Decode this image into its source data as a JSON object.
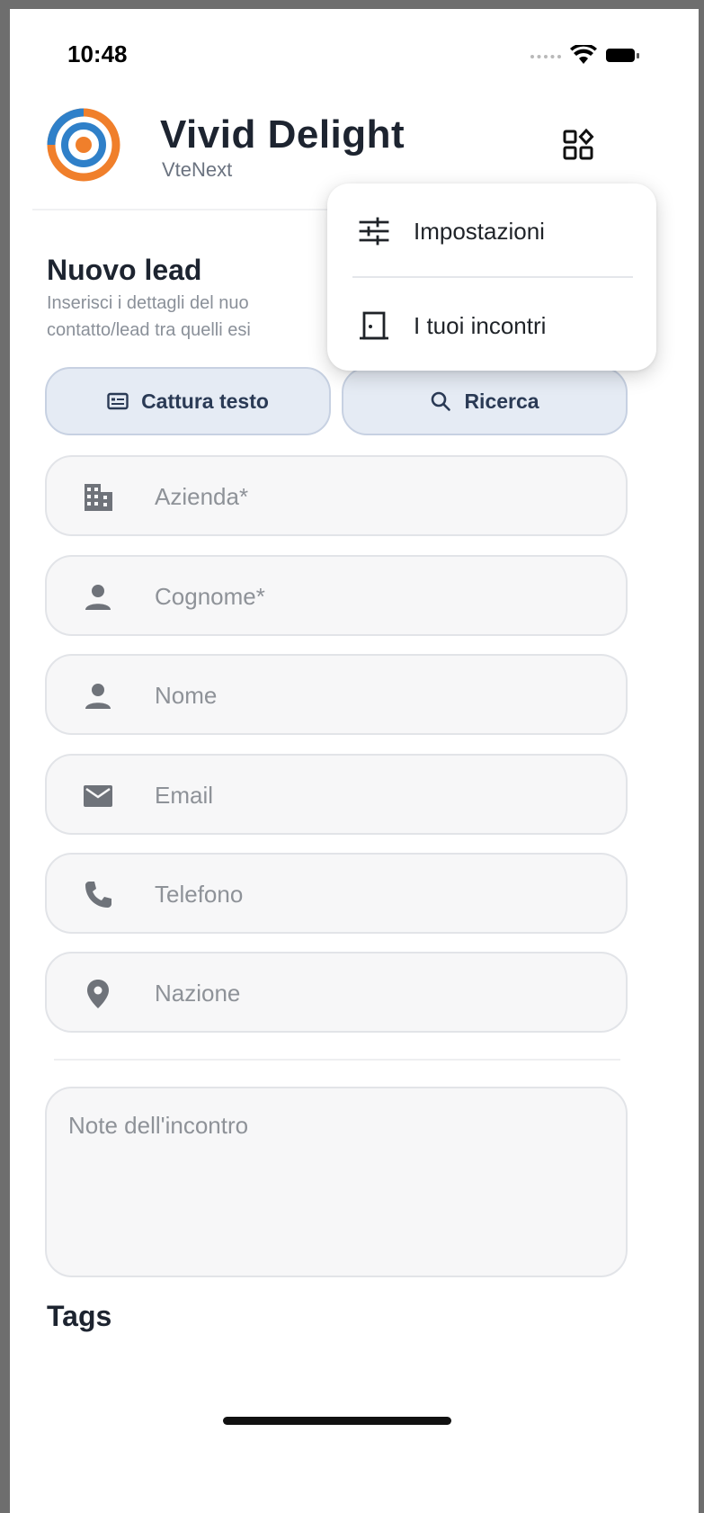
{
  "status_bar": {
    "time": "10:48"
  },
  "header": {
    "app_name": "Vivid Delight",
    "app_subtitle": "VteNext",
    "logo_colors": [
      "#2f80c9",
      "#f07f2b"
    ]
  },
  "section": {
    "title": "Nuovo lead",
    "description_line1": "Inserisci i dettagli del nuo",
    "description_line2": "contatto/lead tra quelli esi"
  },
  "actions": {
    "capture_label": "Cattura testo",
    "search_label": "Ricerca"
  },
  "form": {
    "fields": [
      {
        "icon": "building-icon",
        "placeholder": "Azienda*"
      },
      {
        "icon": "person-icon",
        "placeholder": "Cognome*"
      },
      {
        "icon": "person-icon",
        "placeholder": "Nome"
      },
      {
        "icon": "mail-icon",
        "placeholder": "Email"
      },
      {
        "icon": "phone-icon",
        "placeholder": "Telefono"
      },
      {
        "icon": "location-pin-icon",
        "placeholder": "Nazione"
      }
    ],
    "notes_placeholder": "Note dell'incontro"
  },
  "tags": {
    "title": "Tags"
  },
  "menu": {
    "items": [
      {
        "icon": "sliders-icon",
        "label": "Impostazioni"
      },
      {
        "icon": "door-icon",
        "label": "I tuoi incontri"
      }
    ]
  },
  "colors": {
    "accent_button_bg": "#e5ebf4",
    "accent_button_text": "#2a3a55",
    "field_bg": "#f7f7f8"
  }
}
